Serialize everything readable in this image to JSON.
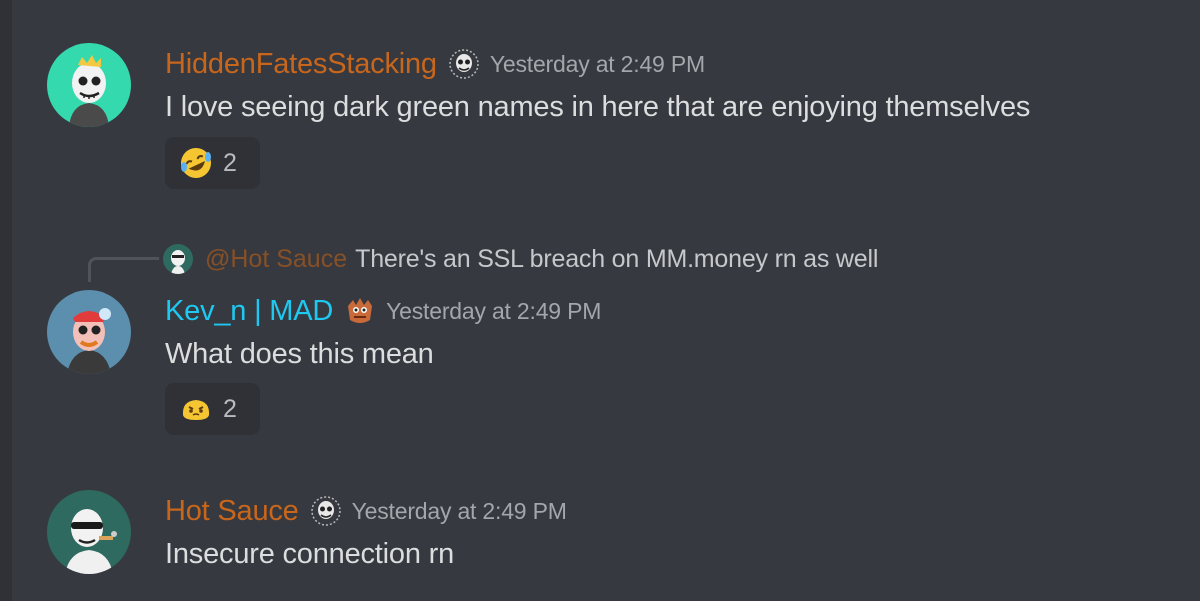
{
  "messages": [
    {
      "username": "HiddenFatesStacking",
      "username_color": "#c8661c",
      "avatar_icon": "skull-avatar-teal-icon",
      "badge_icon": "skull-badge-icon",
      "timestamp": "Yesterday at 2:49 PM",
      "content": "I love seeing dark green names in here that are enjoying themselves",
      "reaction": {
        "emoji_icon": "rolling-on-floor-laughing-emoji-icon",
        "count": "2"
      }
    },
    {
      "reply": {
        "mention": "@Hot Sauce",
        "text": "There's an SSL breach on MM.money rn as well"
      },
      "username": "Kev_n | MAD",
      "username_color": "#1ec8f0",
      "avatar_icon": "skull-avatar-blue-icon",
      "badge_icon": "orange-creature-badge-icon",
      "timestamp": "Yesterday at 2:49 PM",
      "content": "What does this mean",
      "reaction": {
        "emoji_icon": "yellow-blob-emoji-icon",
        "count": "2"
      }
    },
    {
      "username": "Hot Sauce",
      "username_color": "#c8661c",
      "avatar_icon": "skull-avatar-darkteal-icon",
      "badge_icon": "skull-badge-icon",
      "timestamp": "Yesterday at 2:49 PM",
      "content": "Insecure connection rn"
    }
  ],
  "colors": {
    "background": "#36393f",
    "timestamp": "#a3a6aa",
    "text": "#dcddde",
    "reaction_bg": "#2f3136"
  }
}
